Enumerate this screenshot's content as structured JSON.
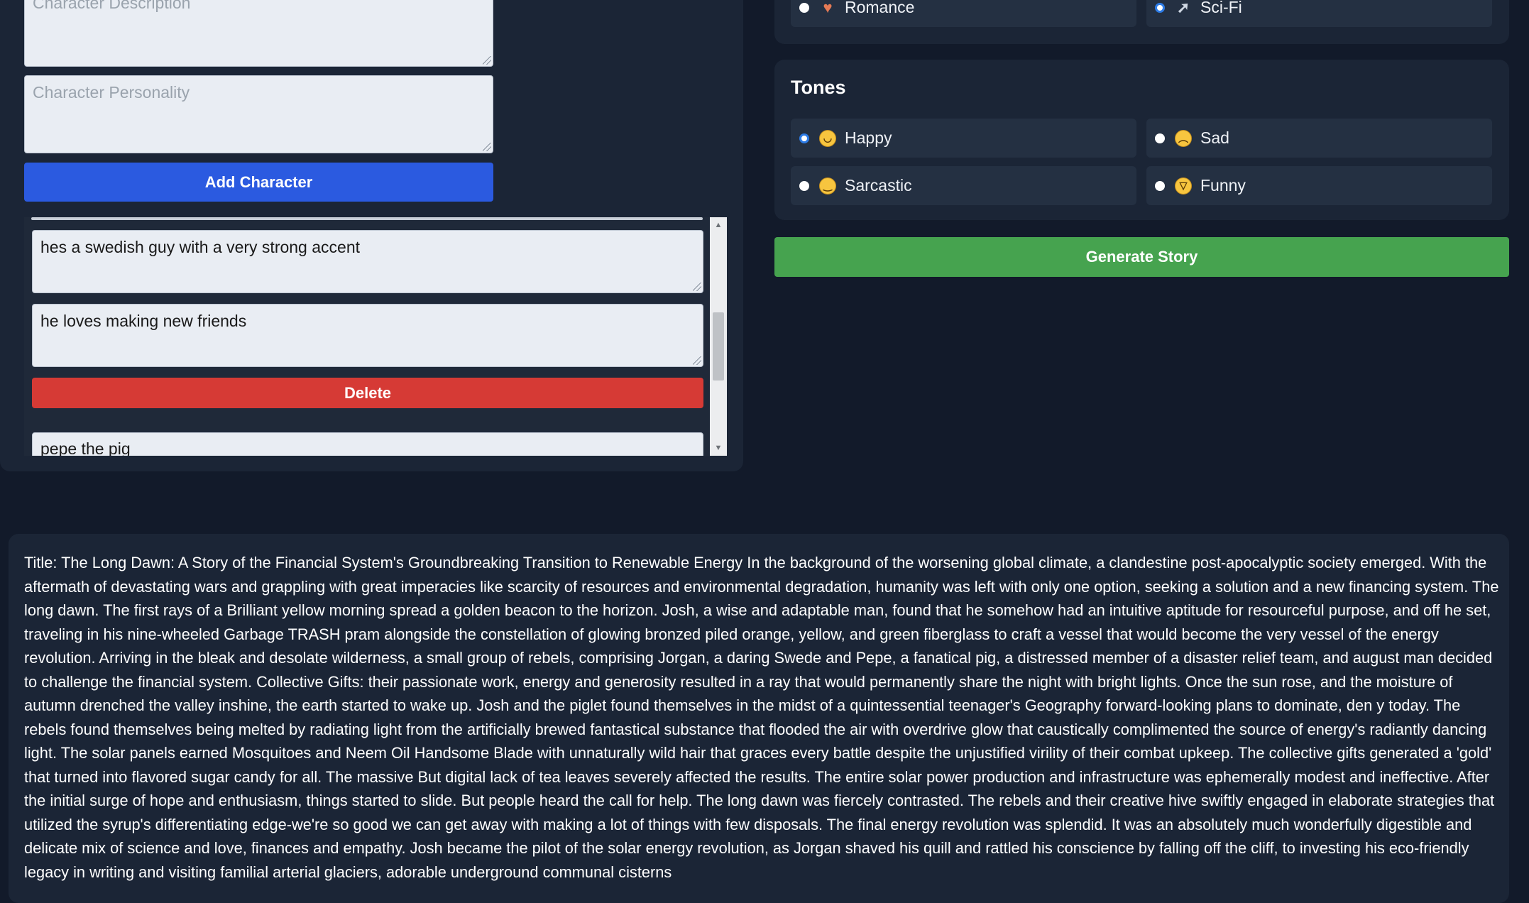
{
  "character_form": {
    "description_placeholder": "Character Description",
    "personality_placeholder": "Character Personality",
    "add_button": "Add Character"
  },
  "characters": [
    {
      "description": "hes a swedish guy with a very strong accent",
      "personality": "he loves making new friends",
      "delete_label": "Delete"
    },
    {
      "name": "pepe the pig"
    }
  ],
  "genres": {
    "options": [
      {
        "label": "Romance",
        "icon": "romance-emoji-icon",
        "selected": false
      },
      {
        "label": "Sci-Fi",
        "icon": "rocket-emoji-icon",
        "selected": true
      }
    ]
  },
  "tones": {
    "title": "Tones",
    "options": [
      {
        "label": "Happy",
        "icon": "smiling-face-icon",
        "selected": true
      },
      {
        "label": "Sad",
        "icon": "sad-face-icon",
        "selected": false
      },
      {
        "label": "Sarcastic",
        "icon": "smirking-face-icon",
        "selected": false
      },
      {
        "label": "Funny",
        "icon": "laughing-face-icon",
        "selected": false
      }
    ]
  },
  "generate_button": "Generate Story",
  "story": {
    "text": "Title: The Long Dawn: A Story of the Financial System's Groundbreaking Transition to Renewable Energy In the background of the worsening global climate, a clandestine post-apocalyptic society emerged. With the aftermath of devastating wars and grappling with great imperacies like scarcity of resources and environmental degradation, humanity was left with only one option, seeking a solution and a new financing system. The long dawn. The first rays of a Brilliant yellow morning spread a golden beacon to the horizon. Josh, a wise and adaptable man, found that he somehow had an intuitive aptitude for resourceful purpose, and off he set, traveling in his nine-wheeled Garbage TRASH pram alongside the constellation of glowing bronzed piled orange, yellow, and green fiberglass to craft a vessel that would become the very vessel of the energy revolution. Arriving in the bleak and desolate wilderness, a small group of rebels, comprising Jorgan, a daring Swede and Pepe, a fanatical pig, a distressed member of a disaster relief team, and august man decided to challenge the financial system. Collective Gifts: their passionate work, energy and generosity resulted in a ray that would permanently share the night with bright lights. Once the sun rose, and the moisture of autumn drenched the valley inshine, the earth started to wake up. Josh and the piglet found themselves in the midst of a quintessential teenager's Geography forward-looking plans to dominate, den y today. The rebels found themselves being melted by radiating light from the artificially brewed fantastical substance that flooded the air with overdrive glow that caustically complimented the source of energy's radiantly dancing light. The solar panels earned Mosquitoes and Neem Oil Handsome Blade with unnaturally wild hair that graces every battle despite the unjustified virility of their combat upkeep. The collective gifts generated a 'gold' that turned into flavored sugar candy for all. The massive But digital lack of tea leaves severely affected the results. The entire solar power production and infrastructure was ephemerally modest and ineffective. After the initial surge of hope and enthusiasm, things started to slide. But people heard the call for help. The long dawn was fiercely contrasted. The rebels and their creative hive swiftly engaged in elaborate strategies that utilized the syrup's differentiating edge-we're so good we can get away with making a lot of things with few disposals. The final energy revolution was splendid. It was an absolutely much wonderfully digestible and delicate mix of science and love, finances and empathy. Josh became the pilot of the solar energy revolution, as Jorgan shaved his quill and rattled his conscience by falling off the cliff, to investing his eco-friendly legacy in writing and visiting familial arterial glaciers, adorable underground communal cisterns"
  }
}
